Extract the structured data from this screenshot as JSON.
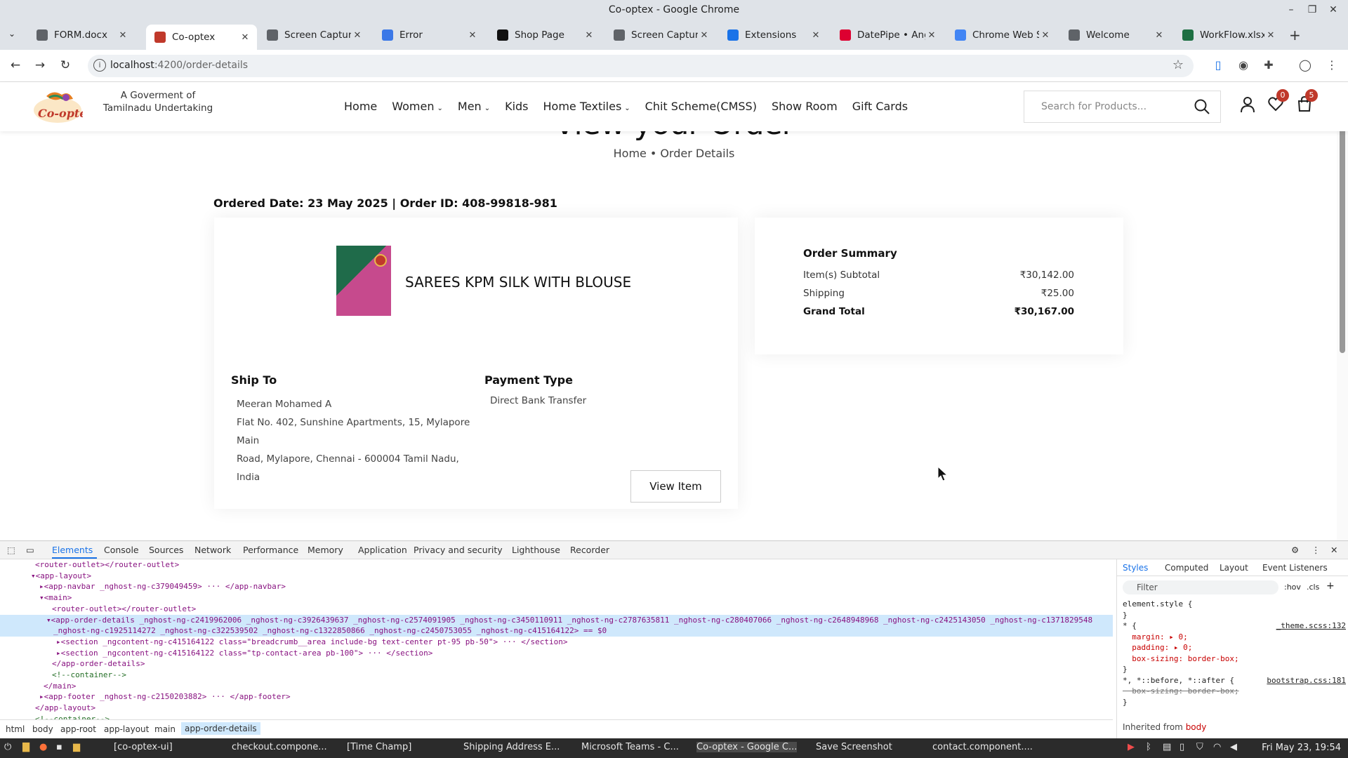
{
  "window": {
    "title": "Co-optex - Google Chrome"
  },
  "tabs": [
    {
      "label": "FORM.docx",
      "icon": "globe-icon",
      "color": "#5f6368"
    },
    {
      "label": "Co-optex",
      "icon": "co-optex-favicon",
      "color": "#c0392b",
      "active": true
    },
    {
      "label": "Screen Capture",
      "icon": "camera-icon",
      "color": "#5f6368"
    },
    {
      "label": "Error",
      "icon": "grid-icon",
      "color": "#3b78e7"
    },
    {
      "label": "Shop Page",
      "icon": "a-icon",
      "color": "#111111"
    },
    {
      "label": "Screen Capture",
      "icon": "camera-icon",
      "color": "#5f6368"
    },
    {
      "label": "Extensions",
      "icon": "puzzle-icon",
      "color": "#1a73e8"
    },
    {
      "label": "DatePipe • Ang",
      "icon": "angular-icon",
      "color": "#dd0031"
    },
    {
      "label": "Chrome Web St",
      "icon": "google-icon",
      "color": "#4285f4"
    },
    {
      "label": "Welcome",
      "icon": "camera-icon",
      "color": "#5f6368"
    },
    {
      "label": "WorkFlow.xlsx",
      "icon": "excel-icon",
      "color": "#1d6f42"
    }
  ],
  "address": {
    "host": "localhost",
    "path": ":4200/order-details"
  },
  "site": {
    "tagline": "A Goverment of Tamilnadu Undertaking",
    "nav": [
      {
        "label": "Home",
        "dropdown": false
      },
      {
        "label": "Women",
        "dropdown": true
      },
      {
        "label": "Men",
        "dropdown": true
      },
      {
        "label": "Kids",
        "dropdown": false
      },
      {
        "label": "Home Textiles",
        "dropdown": true
      },
      {
        "label": "Chit Scheme(CMSS)",
        "dropdown": false
      },
      {
        "label": "Show Room",
        "dropdown": false
      },
      {
        "label": "Gift Cards",
        "dropdown": false
      }
    ],
    "search_placeholder": "Search for Products...",
    "wishlist_count": "0",
    "cart_count": "5"
  },
  "page": {
    "heading": "View your Order",
    "breadcrumb": {
      "home": "Home",
      "sep": "•",
      "current": "Order Details"
    },
    "order_meta": "Ordered Date: 23 May 2025 | Order ID: 408-99818-981",
    "product_name": "SAREES KPM SILK WITH BLOUSE",
    "ship_to_title": "Ship To",
    "ship_to_lines": [
      "Meeran Mohamed A",
      "Flat No. 402, Sunshine Apartments, 15, Mylapore Main",
      "Road, Mylapore, Chennai - 600004 Tamil Nadu, India"
    ],
    "payment_title": "Payment Type",
    "payment_value": "Direct Bank Transfer",
    "view_item_label": "View Item",
    "summary": {
      "title": "Order Summary",
      "rows": [
        {
          "label": "Item(s) Subtotal",
          "value": "₹30,142.00"
        },
        {
          "label": "Shipping",
          "value": "₹25.00"
        },
        {
          "label": "Grand Total",
          "value": "₹30,167.00"
        }
      ]
    }
  },
  "devtools": {
    "tabs": [
      "Elements",
      "Console",
      "Sources",
      "Network",
      "Performance",
      "Memory",
      "Application",
      "Privacy and security",
      "Lighthouse",
      "Recorder"
    ],
    "dom_lines": [
      "<router-outlet></router-outlet>",
      "▾<app-layout>",
      "▸<app-navbar _nghost-ng-c379049459> ··· </app-navbar>",
      "▾<main>",
      "<router-outlet></router-outlet>",
      "▾<app-order-details _nghost-ng-c2419962006 _nghost-ng-c3926439637 _nghost-ng-c2574091905 _nghost-ng-c3450110911 _nghost-ng-c2787635811 _nghost-ng-c280407066 _nghost-ng-c2648948968 _nghost-ng-c2425143050 _nghost-ng-c1371829548",
      "_nghost-ng-c1925114272 _nghost-ng-c322539502 _nghost-ng-c1322850866 _nghost-ng-c2450753055 _nghost-ng-c415164122> == $0",
      "▸<section _ngcontent-ng-c415164122 class=\"breadcrumb__area include-bg text-center pt-95 pb-50\"> ··· </section>",
      "▸<section _ngcontent-ng-c415164122 class=\"tp-contact-area pb-100\"> ··· </section>",
      "</app-order-details>",
      "<!--container-->",
      "</main>",
      "▸<app-footer _nghost-ng-c2150203882> ··· </app-footer>",
      "</app-layout>",
      "<!--container-->"
    ],
    "dom_indents": [
      50,
      44,
      56,
      56,
      74,
      66,
      76,
      80,
      80,
      74,
      74,
      62,
      56,
      50,
      50
    ],
    "styles_tabs": [
      "Styles",
      "Computed",
      "Layout",
      "Event Listeners"
    ],
    "filter_placeholder": "Filter",
    "hov": ":hov",
    "cls": ".cls",
    "styles_lines": [
      {
        "text": "element.style {",
        "type": "sel"
      },
      {
        "text": "}",
        "type": "sel"
      },
      {
        "text": "* {",
        "type": "sel",
        "src": "_theme.scss:132"
      },
      {
        "text": "  margin: ▸ 0;",
        "type": "prop"
      },
      {
        "text": "  padding: ▸ 0;",
        "type": "prop"
      },
      {
        "text": "  box-sizing: border-box;",
        "type": "prop"
      },
      {
        "text": "}",
        "type": "sel"
      },
      {
        "text": "*, *::before, *::after {",
        "type": "sel",
        "src": "bootstrap.css:181"
      },
      {
        "text": "  box-sizing: border-box;",
        "type": "strike"
      },
      {
        "text": "}",
        "type": "sel"
      }
    ],
    "inherited": "Inherited from",
    "inherited_el": "body",
    "breadcrumbs": [
      "html",
      "body",
      "app-root",
      "app-layout",
      "main",
      "app-order-details"
    ]
  },
  "taskbar": {
    "items": [
      "[co-optex-ui]",
      "checkout.compone...",
      "[Time Champ]",
      "Shipping Address E...",
      "Microsoft Teams - C...",
      "Co-optex - Google C...",
      "Save Screenshot",
      "contact.component...."
    ],
    "clock": "Fri May 23, 19:54"
  }
}
